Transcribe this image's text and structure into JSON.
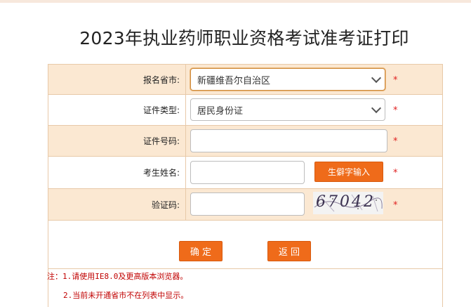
{
  "page": {
    "title": "2023年执业药师职业资格考试准考证打印"
  },
  "form": {
    "province": {
      "label": "报名省市:",
      "value": "新疆维吾尔自治区"
    },
    "id_type": {
      "label": "证件类型:",
      "value": "居民身份证"
    },
    "id_number": {
      "label": "证件号码:",
      "value": ""
    },
    "name": {
      "label": "考生姓名:",
      "value": "",
      "rare_char_button": "生僻字输入"
    },
    "captcha": {
      "label": "验证码:",
      "value": "",
      "image_text": "67042"
    },
    "required_mark": "*"
  },
  "buttons": {
    "confirm": "确 定",
    "back": "返 回"
  },
  "notes": [
    "注：1.请使用IE8.0及更高版本浏览器。",
    "2.当前未开通省市不在列表中显示。"
  ],
  "colors": {
    "accent": "#ef6b1a",
    "row_alt": "#fbe8d2",
    "required": "#e02020"
  }
}
